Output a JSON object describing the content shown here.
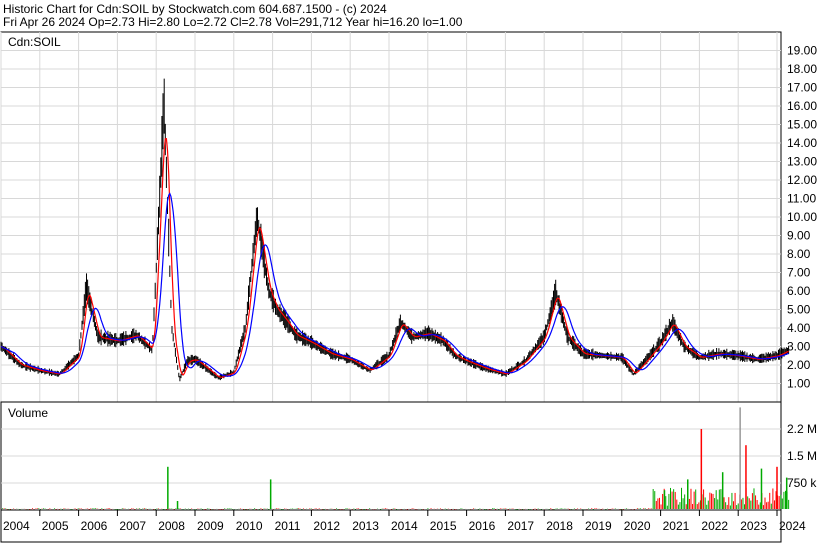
{
  "header": {
    "line1": "Historic Chart for Cdn:SOIL by Stockwatch.com 604.687.1500 - (c) 2024",
    "line2": "Fri Apr 26 2024   Op=2.73   Hi=2.80   Lo=2.72   Cl=2.78   Vol=291,712   Year hi=16.20   lo=1.00"
  },
  "chart_data": [
    {
      "type": "line",
      "title": "Cdn:SOIL",
      "ylim": [
        0,
        20
      ],
      "y_ticks": [
        "1.00",
        "2.00",
        "3.00",
        "4.00",
        "5.00",
        "6.00",
        "7.00",
        "8.00",
        "9.00",
        "10.00",
        "11.00",
        "12.00",
        "13.00",
        "14.00",
        "15.00",
        "16.00",
        "17.00",
        "18.00",
        "19.00"
      ],
      "x_ticks": [
        "2004",
        "2005",
        "2006",
        "2007",
        "2008",
        "2009",
        "2010",
        "2011",
        "2012",
        "2013",
        "2014",
        "2015",
        "2016",
        "2017",
        "2018",
        "2019",
        "2020",
        "2021",
        "2022",
        "2023",
        "2024"
      ],
      "grid": true,
      "series": [
        {
          "name": "",
          "color": "#000000",
          "x": [
            2004.0,
            2004.5,
            2005.0,
            2005.5,
            2006.0,
            2006.2,
            2006.5,
            2007.0,
            2007.5,
            2007.9,
            2008.1,
            2008.2,
            2008.4,
            2008.6,
            2008.8,
            2009.0,
            2009.3,
            2009.6,
            2010.0,
            2010.3,
            2010.6,
            2010.9,
            2011.1,
            2011.3,
            2011.6,
            2012.0,
            2012.5,
            2013.0,
            2013.5,
            2014.0,
            2014.3,
            2014.6,
            2015.0,
            2015.4,
            2015.7,
            2016.0,
            2016.5,
            2017.0,
            2017.5,
            2018.0,
            2018.3,
            2018.6,
            2019.0,
            2019.5,
            2020.0,
            2020.3,
            2020.6,
            2021.0,
            2021.3,
            2021.6,
            2022.0,
            2022.5,
            2023.0,
            2023.5,
            2024.0,
            2024.3
          ],
          "values": [
            3.0,
            2.0,
            1.7,
            1.5,
            2.5,
            6.2,
            3.5,
            3.3,
            3.6,
            2.8,
            11.5,
            16.2,
            4.0,
            1.2,
            2.2,
            2.3,
            1.8,
            1.3,
            1.6,
            4.0,
            10.0,
            6.0,
            5.0,
            4.5,
            3.6,
            3.2,
            2.6,
            2.3,
            1.7,
            2.5,
            4.3,
            3.5,
            3.7,
            3.3,
            2.5,
            2.2,
            1.8,
            1.5,
            2.2,
            3.5,
            5.9,
            3.5,
            2.6,
            2.5,
            2.4,
            1.5,
            2.2,
            3.2,
            4.3,
            3.0,
            2.4,
            2.6,
            2.5,
            2.3,
            2.5,
            2.8
          ]
        },
        {
          "name": "",
          "color": "#ff0000"
        },
        {
          "name": "",
          "color": "#0000ff"
        }
      ]
    },
    {
      "type": "bar",
      "title": "Volume",
      "ylim": [
        0,
        3000000
      ],
      "y_ticks": [
        "750 k",
        "1.5 M",
        "2.2 M"
      ],
      "spikes": [
        {
          "x": 2008.3,
          "value": 1200000,
          "color": "#00aa00"
        },
        {
          "x": 2008.55,
          "value": 250000,
          "color": "#00aa00"
        },
        {
          "x": 2010.95,
          "value": 850000,
          "color": "#00aa00"
        },
        {
          "x": 2021.1,
          "value": 550000,
          "color": "#00aa00"
        },
        {
          "x": 2021.7,
          "value": 850000,
          "color": "#00aa00"
        },
        {
          "x": 2022.05,
          "value": 2250000,
          "color": "#ff0000"
        },
        {
          "x": 2022.6,
          "value": 1050000,
          "color": "#00aa00"
        },
        {
          "x": 2023.05,
          "value": 2850000,
          "color": "#999999"
        },
        {
          "x": 2023.2,
          "value": 1800000,
          "color": "#ff0000"
        },
        {
          "x": 2023.6,
          "value": 1150000,
          "color": "#00aa00"
        },
        {
          "x": 2024.0,
          "value": 1200000,
          "color": "#ff0000"
        },
        {
          "x": 2024.25,
          "value": 900000,
          "color": "#00aa00"
        }
      ]
    }
  ]
}
